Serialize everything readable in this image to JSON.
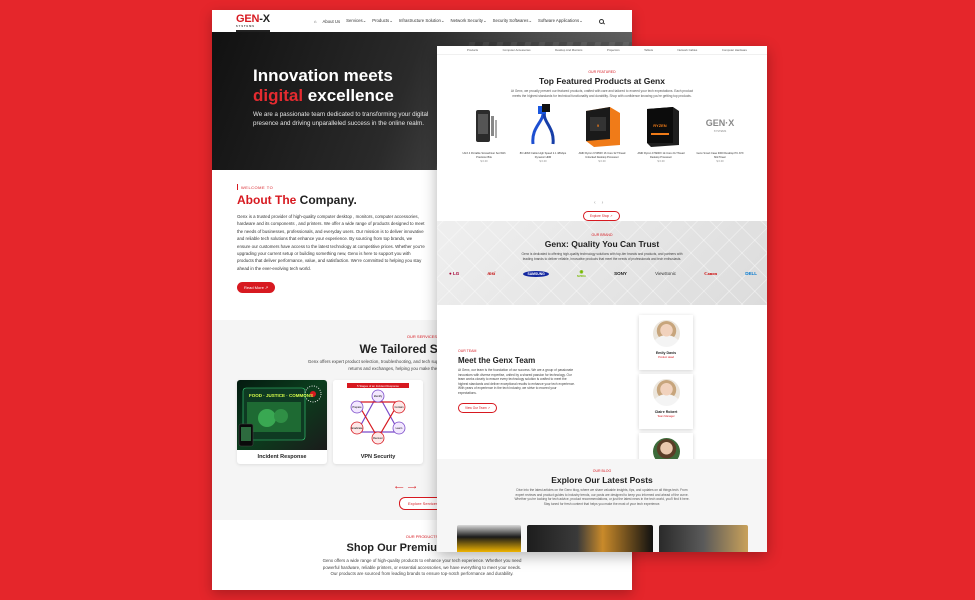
{
  "left_page": {
    "logo": {
      "brand_main": "GEN",
      "brand_x": "-X",
      "brand_sub": "SYSTEMS"
    },
    "nav": [
      "About Us",
      "Services",
      "Products",
      "Infrastructure Solution",
      "Network Security",
      "Security Softwares",
      "Software Applications"
    ],
    "hero": {
      "title_line1": "Innovation meets",
      "title_red": "digital",
      "title_rest": " excellence",
      "subtitle": "We are a passionate team dedicated to transforming your digital presence and driving unparalleled success in the online realm."
    },
    "about": {
      "eyebrow": "WELCOME TO",
      "title_red": "About The",
      "title_rest": " Company.",
      "body": "Genx is a trusted provider of high-quality computer desktop , monitors, computer accessories, hardware and its components , and printers. We offer a wide range of products designed to meet the needs of businesses, professionals, and everyday users. Our mission is to deliver innovative and reliable tech solutions that enhance your experience. By sourcing from top brands, we ensure our customers have access to the latest technology at competitive prices. Whether you're upgrading your current setup or building something new, Genx is here to support you with products that deliver performance, value, and satisfaction. We're committed to helping you stay ahead in the ever-evolving tech world.",
      "button": "Read More"
    },
    "services": {
      "eyebrow": "OUR SERVICES",
      "title": "We Tailored Solutions",
      "body": "Genx offers expert product selection, troubleshooting, and tech support to help you find the right technology with easy returns and exchanges, helping you make the best choices with confidence.",
      "cards": [
        {
          "label": "Incident Response",
          "image_text": "FOOD · JUSTICE · COMMONS"
        },
        {
          "label": "VPN Security",
          "image_text": "5 Stages of an Incident Response",
          "nodes": [
            "Identify",
            "Prepare",
            "Contain",
            "Eradicate",
            "Recover",
            "Learn"
          ]
        }
      ],
      "button": "Explore Services"
    },
    "shop": {
      "eyebrow": "OUR PRODUCTS",
      "title": "Shop Our Premium Products",
      "body": "Genx offers a wide range of high-quality products to enhance your tech experience. Whether you need powerful hardware, reliable printers, or essential accessories, we have everything to meet your needs. Our products are sourced from leading brands to ensure top-notch performance and durability."
    }
  },
  "right_page": {
    "category_nav": [
      "Products",
      "Computer Accessories",
      "Desktop And Monitors",
      "Projectors",
      "Tablets",
      "Network Cables",
      "Computer Hardware"
    ],
    "featured": {
      "eyebrow": "OUR FEATURED",
      "title": "Top Featured Products at Genx",
      "body": "At Genx, we proudly present our featured products, crafted with care and tailored to exceed your tech expectations. Each product meets the highest standards for technical functionality and durability. Shop with confidence knowing you're getting top products.",
      "products": [
        {
          "name": "UGX 4 Portable Screwdriver Set With Precision Bits",
          "price": "$ 0.00"
        },
        {
          "name": "8K HDMI Cable High Speed 2.1 48Gbps Dynamic HDR",
          "price": "$ 0.00"
        },
        {
          "name": "AMD Ryzen 9 5950X 16 Core 32 Thread Unlocked Desktop Processor",
          "price": "$ 0.00"
        },
        {
          "name": "AMD Ryzen 9 5900X 12-Core 24-Thread Desktop Processor",
          "price": "$ 0.00"
        },
        {
          "name": "Genx Smart Case 3000 Desktop PC ATX Mid Tower",
          "price": "$ 0.00"
        }
      ],
      "button": "Explore Shop"
    },
    "brands": {
      "eyebrow": "OUR BRAND",
      "title": "Genx: Quality You Can Trust",
      "body": "Genx is dedicated to offering high-quality technology solutions with top-tier brands and products, and partners with leading brands to deliver reliable, innovative products that meet the needs of professionals and tech enthusiasts.",
      "logos": [
        {
          "name": "LG",
          "color": "#a50034"
        },
        {
          "name": "msi",
          "color": "#c00000"
        },
        {
          "name": "SAMSUNG",
          "color": "#1428a0"
        },
        {
          "name": "NVIDIA",
          "color": "#76b900"
        },
        {
          "name": "SONY",
          "color": "#111111"
        },
        {
          "name": "ViewSonic",
          "color": "#333333"
        },
        {
          "name": "Canon",
          "color": "#cc0000"
        },
        {
          "name": "DELL",
          "color": "#0076ce"
        }
      ]
    },
    "team": {
      "eyebrow": "OUR TEAM",
      "title": "Meet the Genx Team",
      "body": "At Genx, our team is the foundation of our success. We are a group of passionate innovators with diverse expertise, united by a shared passion for technology. Our team works closely to ensure every technology solution is crafted to meet the highest standards and deliver exceptional results to enhance your tech experience. With years of experience in the tech industry, we strive to exceed your expectations.",
      "button": "View Our Team",
      "members": [
        {
          "name": "Emily Davis",
          "role": "Product Head"
        },
        {
          "name": "Claire Robert",
          "role": "Team Manager"
        },
        {
          "name": "",
          "role": ""
        }
      ]
    },
    "posts": {
      "eyebrow": "OUR BLOG",
      "title": "Explore Our Latest Posts",
      "body": "Dive into the latest articles on the Genx blog, where we share valuable insights, tips, and updates on all things tech. From expert reviews and product guides to industry trends, our posts are designed to keep you informed and ahead of the curve. Whether you're looking for tech advice, product recommendations, or just the latest news in the tech world, you'll find it here. Stay tuned for fresh content that helps you make the most of your tech experience."
    }
  }
}
